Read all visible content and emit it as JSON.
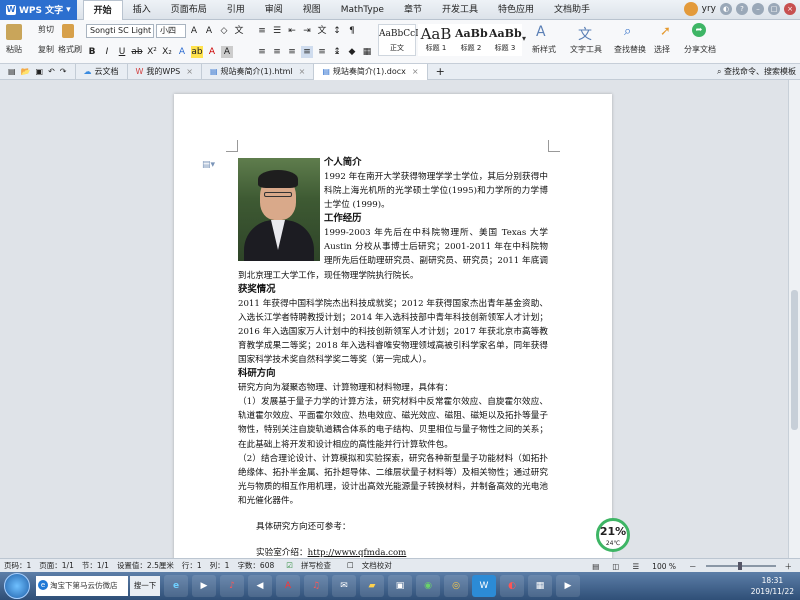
{
  "app": {
    "name": "WPS 文字"
  },
  "menu": [
    "开始",
    "插入",
    "页面布局",
    "引用",
    "审阅",
    "视图",
    "MathType",
    "章节",
    "开发工具",
    "特色应用",
    "文档助手"
  ],
  "user": {
    "name": "yry"
  },
  "ribbon": {
    "paste": "粘贴",
    "cut": "剪切",
    "copy": "复制",
    "format_painter": "格式刷",
    "font_name": "Songti SC Light",
    "font_size": "小四",
    "styles": [
      {
        "sample": "AaBbCcI",
        "label": "正文"
      },
      {
        "sample": "AaB",
        "label": "标题 1"
      },
      {
        "sample": "AaBb(",
        "label": "标题 2"
      },
      {
        "sample": "AaBb",
        "label": "标题 3"
      }
    ],
    "new_style": "新样式",
    "text_tools": "文字工具",
    "find_replace": "查找替换",
    "select": "选择",
    "share": "分享文档"
  },
  "tabs": {
    "items": [
      {
        "label": "云文档"
      },
      {
        "label": "我的WPS"
      },
      {
        "label": "规站奏简介(1).html"
      },
      {
        "label": "规站奏简介(1).docx"
      }
    ],
    "search": "查找命令、搜索模板"
  },
  "doc": {
    "h_intro": "个人简介",
    "p_intro": "1992 年在南开大学获得物理学学士学位，其后分别获得中科院上海光机所的光学硕士学位(1995)和力学所的力学博士学位 (1999)。",
    "h_work": "工作经历",
    "p_work": "1999-2003 年先后在中科院物理所、美国 Texas 大学 Austin 分校从事博士后研究；2001-2011 年在中科院物理所先后任助理研究员、副研究员、研究员；2011 年底调到北京理工大学工作，现任物理学院执行院长。",
    "h_award": "获奖情况",
    "p_award": "2011 年获得中国科学院杰出科技成就奖；2012 年获得国家杰出青年基金资助、入选长江学者特聘教授计划；2014 年入选科技部中青年科技创新领军人才计划；2016 年入选国家万人计划中的科技创新领军人才计划；2017 年获北京市高等教育教学成果二等奖；2018 年入选科睿唯安物理领域高被引科学家名单，同年获得国家科学技术奖自然科学奖二等奖（第一完成人）。",
    "h_research": "科研方向",
    "p_research": "研究方向为凝聚态物理、计算物理和材料物理，具体有：",
    "p_r1": "（1）发展基于量子力学的计算方法，研究材料中反常霍尔效应、自旋霍尔效应、轨道霍尔效应、平面霍尔效应、热电效应、磁光效应、磁阻、磁矩以及拓扑等量子物性，特别关注自旋轨道耦合体系的电子结构、贝里相位与量子物性之间的关系；在此基础上将开发和设计相应的高性能并行计算软件包。",
    "p_r2": "（2）结合理论设计、计算模拟和实验探索，研究各种新型量子功能材料（如拓扑绝缘体、拓扑半金属、拓扑超导体、二维层状量子材料等）及相关物性；通过研究光与物质的相互作用机理，设计出高效光能源量子转换材料，并制备高效的光电池和光催化器件。",
    "p_more": "具体研究方向还可参考：",
    "p_site_label": "实验室介绍：",
    "p_site_url": "http://www.qfmda.com"
  },
  "weather": {
    "percent": "21%",
    "temp": "24℃"
  },
  "status": {
    "page": "页码：1",
    "pages": "页面：1/1",
    "section": "节：1/1",
    "setting": "设置值：2.5厘米",
    "row": "行：1",
    "col": "列：1",
    "words": "字数：608",
    "spell": "拼写检查",
    "proof": "文档校对",
    "zoom": "100 %"
  },
  "taskbar": {
    "search_text": "淘宝下第马云仿微店",
    "search_btn": "搜一下",
    "time": "18:31",
    "date": "2019/11/22"
  }
}
